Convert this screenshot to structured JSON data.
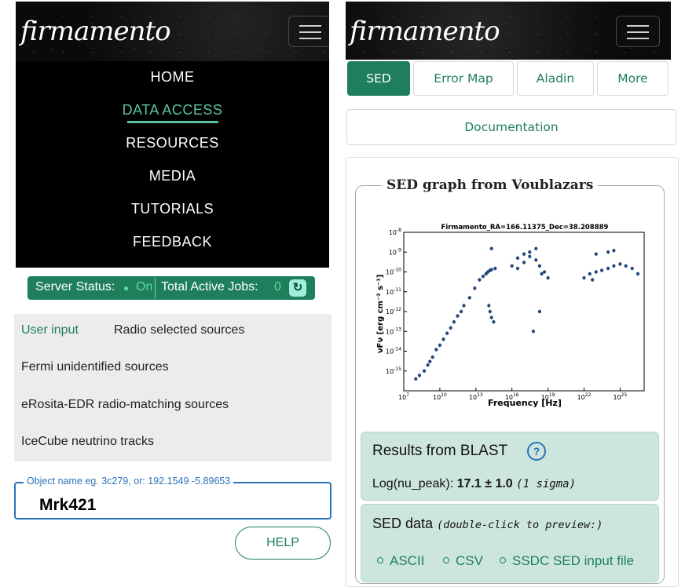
{
  "left": {
    "logo": "firmamento",
    "nav": [
      "HOME",
      "DATA ACCESS",
      "RESOURCES",
      "MEDIA",
      "TUTORIALS",
      "FEEDBACK"
    ],
    "active_nav": "DATA ACCESS",
    "status": {
      "server_label": "Server Status:",
      "server_dot": "●",
      "server_value": "On",
      "jobs_label": "Total Active Jobs:",
      "jobs_value": "0",
      "refresh_icon": "refresh-icon"
    },
    "source_lists": {
      "user_input": "User input",
      "radio": "Radio selected sources",
      "fermi": "Fermi unidentified sources",
      "erosita": "eRosita-EDR radio-matching sources",
      "icecube": "IceCube neutrino tracks"
    },
    "object_field": {
      "legend": "Object name eg. 3c279, or: 192.1549 -5.89653",
      "value": "Mrk421"
    },
    "help_label": "HELP"
  },
  "right": {
    "logo": "firmamento",
    "tabs": [
      "SED",
      "Error Map",
      "Aladin",
      "More"
    ],
    "active_tab": "SED",
    "documentation": "Documentation",
    "graph_card_title": "SED graph from Voublazars",
    "blast": {
      "title": "Results from BLAST",
      "help_icon": "?",
      "label": "Log(nu_peak):",
      "value": "17.1 ± 1.0",
      "note": "(1 sigma)"
    },
    "sed_data": {
      "title": "SED data",
      "note": "(double-click to preview:)",
      "links": [
        "ASCII",
        "CSV",
        "SSDC SED input file"
      ]
    }
  },
  "colors": {
    "accent_green": "#1f7f5c",
    "nav_active": "#5bc39a",
    "panel_teal": "#cde6dd",
    "link_blue": "#2a73b8"
  },
  "chart_data": {
    "type": "scatter",
    "title": "Firmamento_RA=166.11375_Dec=38.208889",
    "xlabel": "Frequency [Hz]",
    "ylabel": "νFν [erg cm⁻² s⁻¹]",
    "x_scale": "log",
    "y_scale": "log",
    "xlim": [
      10000000.0,
      1e+27
    ],
    "ylim": [
      1e-16,
      1e-08
    ],
    "x_ticks": [
      "10^7",
      "10^10",
      "10^13",
      "10^16",
      "10^19",
      "10^22",
      "10^25"
    ],
    "y_ticks": [
      "10^-15",
      "10^-14",
      "10^-13",
      "10^-12",
      "10^-11",
      "10^-10",
      "10^-9",
      "10^-8"
    ],
    "series": [
      {
        "points": [
          [
            100000000.0,
            4e-16
          ],
          [
            200000000.0,
            6e-16
          ],
          [
            500000000.0,
            1e-15
          ],
          [
            1000000000.0,
            2e-15
          ],
          [
            1500000000.0,
            3e-15
          ],
          [
            2500000000.0,
            5e-15
          ],
          [
            5000000000.0,
            1.2e-14
          ],
          [
            10000000000.0,
            2e-14
          ],
          [
            20000000000.0,
            4e-14
          ],
          [
            40000000000.0,
            8e-14
          ],
          [
            80000000000.0,
            1.5e-13
          ],
          [
            150000000000.0,
            3e-13
          ],
          [
            300000000000.0,
            6e-13
          ],
          [
            600000000000.0,
            1e-12
          ],
          [
            1000000000000.0,
            2e-12
          ],
          [
            3000000000000.0,
            5e-12
          ],
          [
            8000000000000.0,
            1.5e-11
          ],
          [
            20000000000000.0,
            4e-11
          ],
          [
            40000000000000.0,
            6e-11
          ],
          [
            70000000000000.0,
            8e-11
          ],
          [
            100000000000000.0,
            1e-10
          ],
          [
            150000000000000.0,
            1.2e-10
          ],
          [
            200000000000000.0,
            1.3e-10
          ],
          [
            400000000000000.0,
            1.5e-10
          ],
          [
            150000000000000.0,
            1e-12
          ],
          [
            200000000000000.0,
            5e-13
          ],
          [
            300000000000000.0,
            3e-13
          ],
          [
            120000000000000.0,
            2e-12
          ],
          [
            200000000000000.0,
            1.5e-09
          ],
          [
            1e+16,
            2e-10
          ],
          [
            3e+16,
            5e-10
          ],
          [
            1e+17,
            8e-10
          ],
          [
            3e+17,
            6e-10
          ],
          [
            1e+18,
            4e-10
          ],
          [
            2e+18,
            2e-10
          ],
          [
            5e+18,
            1e-10
          ],
          [
            1e+19,
            5e-11
          ],
          [
            3e+16,
            1.5e-10
          ],
          [
            1e+17,
            3e-10
          ],
          [
            3e+17,
            1e-09
          ],
          [
            1e+18,
            1.5e-09
          ],
          [
            3e+18,
            8e-11
          ],
          [
            6e+17,
            1e-13
          ],
          [
            2e+18,
            1e-12
          ],
          [
            1e+22,
            5e-11
          ],
          [
            3e+22,
            8e-11
          ],
          [
            1e+23,
            1e-10
          ],
          [
            3e+23,
            1.2e-10
          ],
          [
            1e+24,
            1.5e-10
          ],
          [
            3e+24,
            2e-10
          ],
          [
            1e+25,
            2.5e-10
          ],
          [
            3e+25,
            2e-10
          ],
          [
            1e+26,
            1.5e-10
          ],
          [
            3e+26,
            8e-11
          ],
          [
            1e+24,
            1e-09
          ],
          [
            3e+24,
            1.2e-09
          ],
          [
            1e+23,
            8e-10
          ],
          [
            5e+22,
            4e-11
          ]
        ]
      }
    ]
  }
}
